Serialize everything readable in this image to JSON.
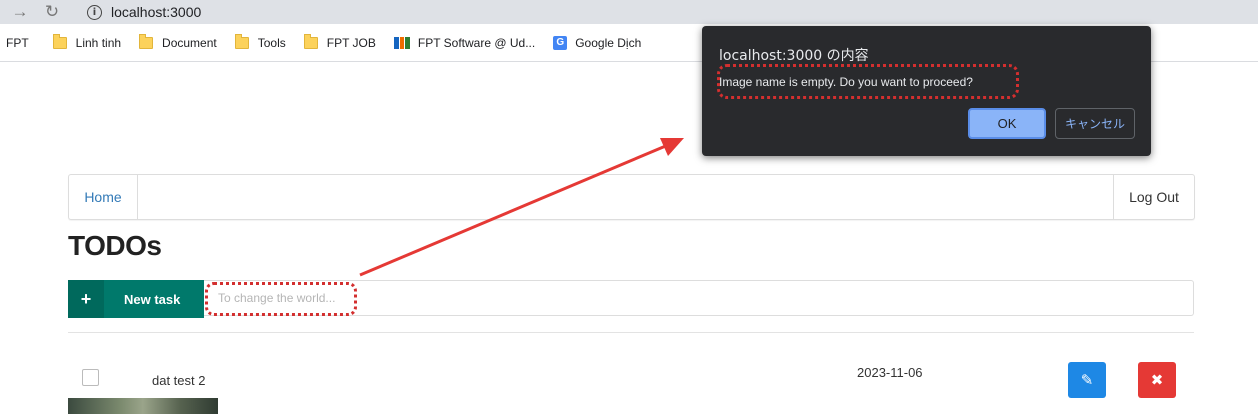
{
  "browser": {
    "url": "localhost:3000",
    "bookmarks": [
      {
        "label": "FPT",
        "icon": "none"
      },
      {
        "label": "Linh tinh",
        "icon": "folder-icon"
      },
      {
        "label": "Document",
        "icon": "folder-icon"
      },
      {
        "label": "Tools",
        "icon": "folder-icon"
      },
      {
        "label": "FPT JOB",
        "icon": "folder-icon"
      },
      {
        "label": "FPT Software @ Ud...",
        "icon": "fpt-logo-icon"
      },
      {
        "label": "Google Dịch",
        "icon": "google-translate-icon"
      }
    ]
  },
  "navbar": {
    "home_label": "Home",
    "logout_label": "Log Out"
  },
  "page": {
    "title": "TODOs",
    "new_task_label": "New task",
    "new_task_icon": "plus-icon",
    "input_placeholder": "To change the world..."
  },
  "tasks": [
    {
      "name": "dat test 2",
      "date": "2023-11-06",
      "done": false
    }
  ],
  "dialog": {
    "title": "localhost:3000 の内容",
    "message": "Image name is empty. Do you want to proceed?",
    "ok_label": "OK",
    "cancel_label": "キャンセル"
  },
  "colors": {
    "accent_teal": "#00796b",
    "edit_blue": "#1e88e5",
    "delete_red": "#e53935",
    "annotation_red": "#d32f2f",
    "dialog_bg": "#292a2d"
  }
}
